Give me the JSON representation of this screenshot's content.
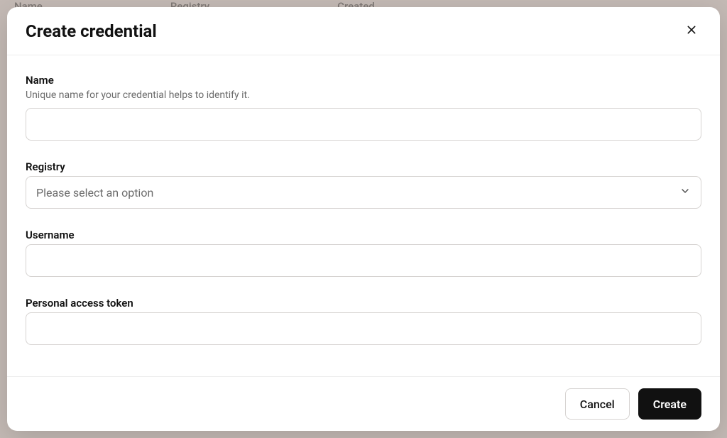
{
  "background": {
    "columns": [
      "Name",
      "Registry",
      "Created"
    ]
  },
  "modal": {
    "title": "Create credential",
    "fields": {
      "name": {
        "label": "Name",
        "hint": "Unique name for your credential helps to identify it.",
        "value": ""
      },
      "registry": {
        "label": "Registry",
        "placeholder": "Please select an option",
        "value": ""
      },
      "username": {
        "label": "Username",
        "value": ""
      },
      "token": {
        "label": "Personal access token",
        "value": ""
      }
    },
    "footer": {
      "cancel": "Cancel",
      "create": "Create"
    }
  }
}
